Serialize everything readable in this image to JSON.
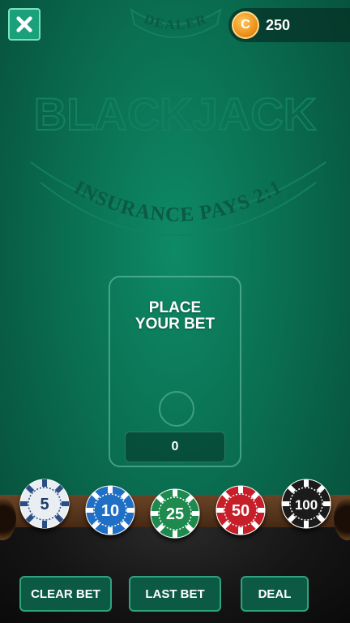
{
  "header": {
    "close_icon": "close-icon",
    "coins": "250",
    "coin_symbol": "C"
  },
  "table": {
    "dealer_label": "DEALER",
    "game_title": "BLACKJACK",
    "insurance_text": "INSURANCE PAYS 2:1"
  },
  "bet_zone": {
    "title_line1": "PLACE",
    "title_line2": "YOUR BET",
    "amount": "0"
  },
  "chips": [
    {
      "value": "5",
      "color": "#e9eef2",
      "text_color": "#1d3a6a"
    },
    {
      "value": "10",
      "color": "#1f6fc4",
      "text_color": "#ffffff"
    },
    {
      "value": "25",
      "color": "#1e8a4e",
      "text_color": "#ffffff"
    },
    {
      "value": "50",
      "color": "#c61f2a",
      "text_color": "#ffffff"
    },
    {
      "value": "100",
      "color": "#1b1b1b",
      "text_color": "#ffffff"
    }
  ],
  "buttons": {
    "clear_bet": "CLEAR BET",
    "last_bet": "LAST BET",
    "deal": "DEAL"
  }
}
